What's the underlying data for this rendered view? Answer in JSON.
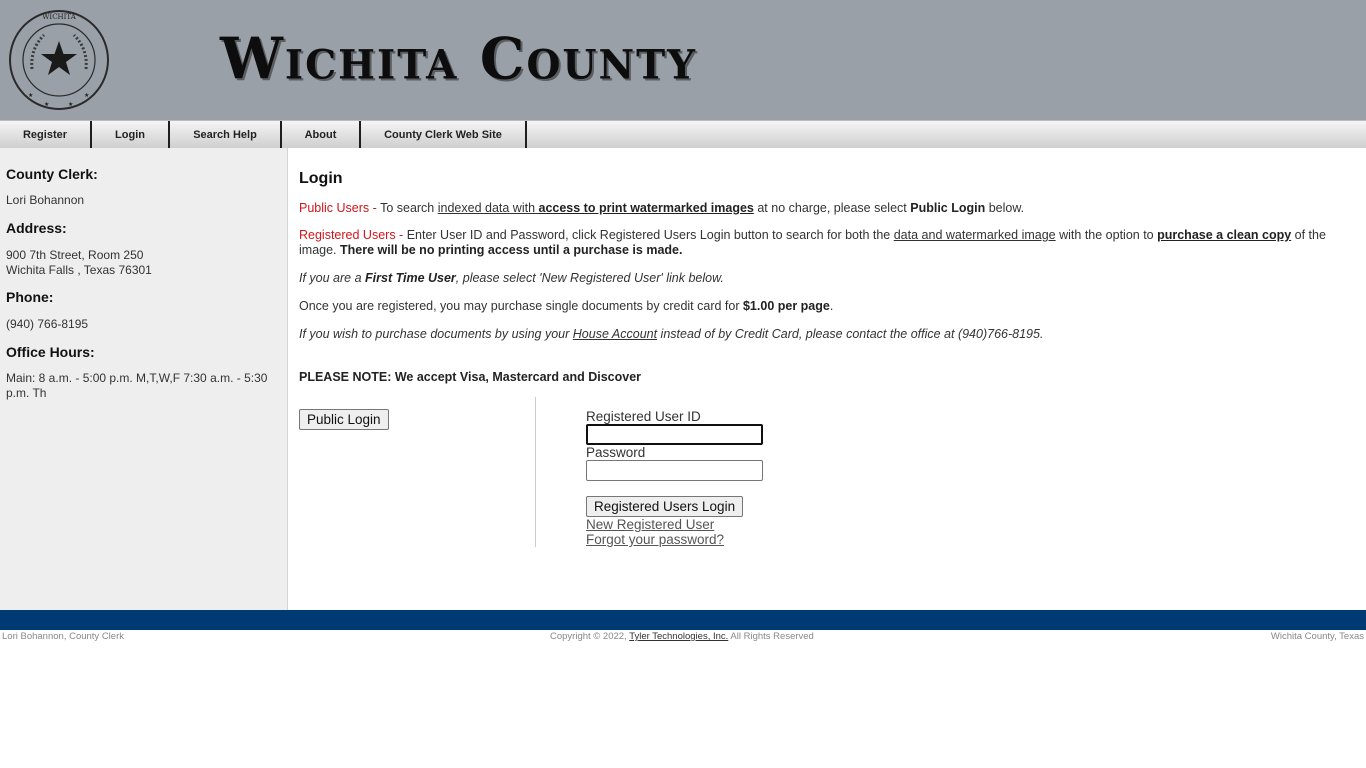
{
  "header": {
    "title": "Wichita County",
    "seal_text": "COUNTY OF WICHITA TEXAS",
    "colors": {
      "header_bg": "#9aa0a7",
      "footer_bar": "#003a75",
      "accent_red": "#d0161c"
    }
  },
  "nav": {
    "items": [
      {
        "label": "Register"
      },
      {
        "label": "Login"
      },
      {
        "label": "Search Help"
      },
      {
        "label": "About"
      },
      {
        "label": "County Clerk Web Site"
      }
    ]
  },
  "sidebar": {
    "clerk_heading": "County Clerk:",
    "clerk_name": "Lori Bohannon",
    "address_heading": "Address:",
    "address_line1": "900 7th Street, Room 250",
    "address_line2": "Wichita Falls , Texas 76301",
    "phone_heading": "Phone:",
    "phone": "(940) 766-8195",
    "hours_heading": "Office Hours:",
    "hours": "Main: 8 a.m. - 5:00 p.m. M,T,W,F 7:30 a.m. - 5:30 p.m. Th"
  },
  "main": {
    "title": "Login",
    "public": {
      "label": "Public Users",
      "sep": " - ",
      "t1": "To search ",
      "u1": "indexed data with ",
      "ub1": "access to print watermarked images",
      "t2": " at no charge, please select ",
      "b1": "Public Login",
      "t3": " below."
    },
    "registered": {
      "label": "Registered Users",
      "sep": " - ",
      "t1": "Enter User ID and Password, click Registered Users Login button to search for both the ",
      "u1": "data and watermarked image",
      "t2": " with the option to ",
      "ub1": "purchase a clean copy",
      "t3": " of the image. ",
      "b1": "There will be no printing access until a purchase is made."
    },
    "first_time": {
      "t1": "If you are a ",
      "b1": "First Time User",
      "t2": ", please select 'New Registered User' link below."
    },
    "purchase": {
      "t1": "Once you are registered, you may purchase single documents by credit card for ",
      "b1": "$1.00 per page",
      "t2": "."
    },
    "house_account": {
      "t1": "If you wish to purchase documents by using your ",
      "u1": "House Account",
      "t2": " instead of by Credit Card, please contact the office at (940)766-8195."
    },
    "note": "PLEASE NOTE: We accept Visa, Mastercard and Discover",
    "public_login_button": "Public Login",
    "user_id_label": "Registered User ID",
    "user_id_value": "",
    "password_label": "Password",
    "password_value": "",
    "registered_login_button": "Registered Users Login",
    "new_user_link": "New Registered User",
    "forgot_password_link": "Forgot your password?"
  },
  "footer": {
    "left": "Lori Bohannon, County Clerk",
    "copyright_prefix": "Copyright © 2022, ",
    "company_link": "Tyler Technologies, Inc.",
    "copyright_suffix": " All Rights Reserved",
    "right": "Wichita County, Texas"
  }
}
